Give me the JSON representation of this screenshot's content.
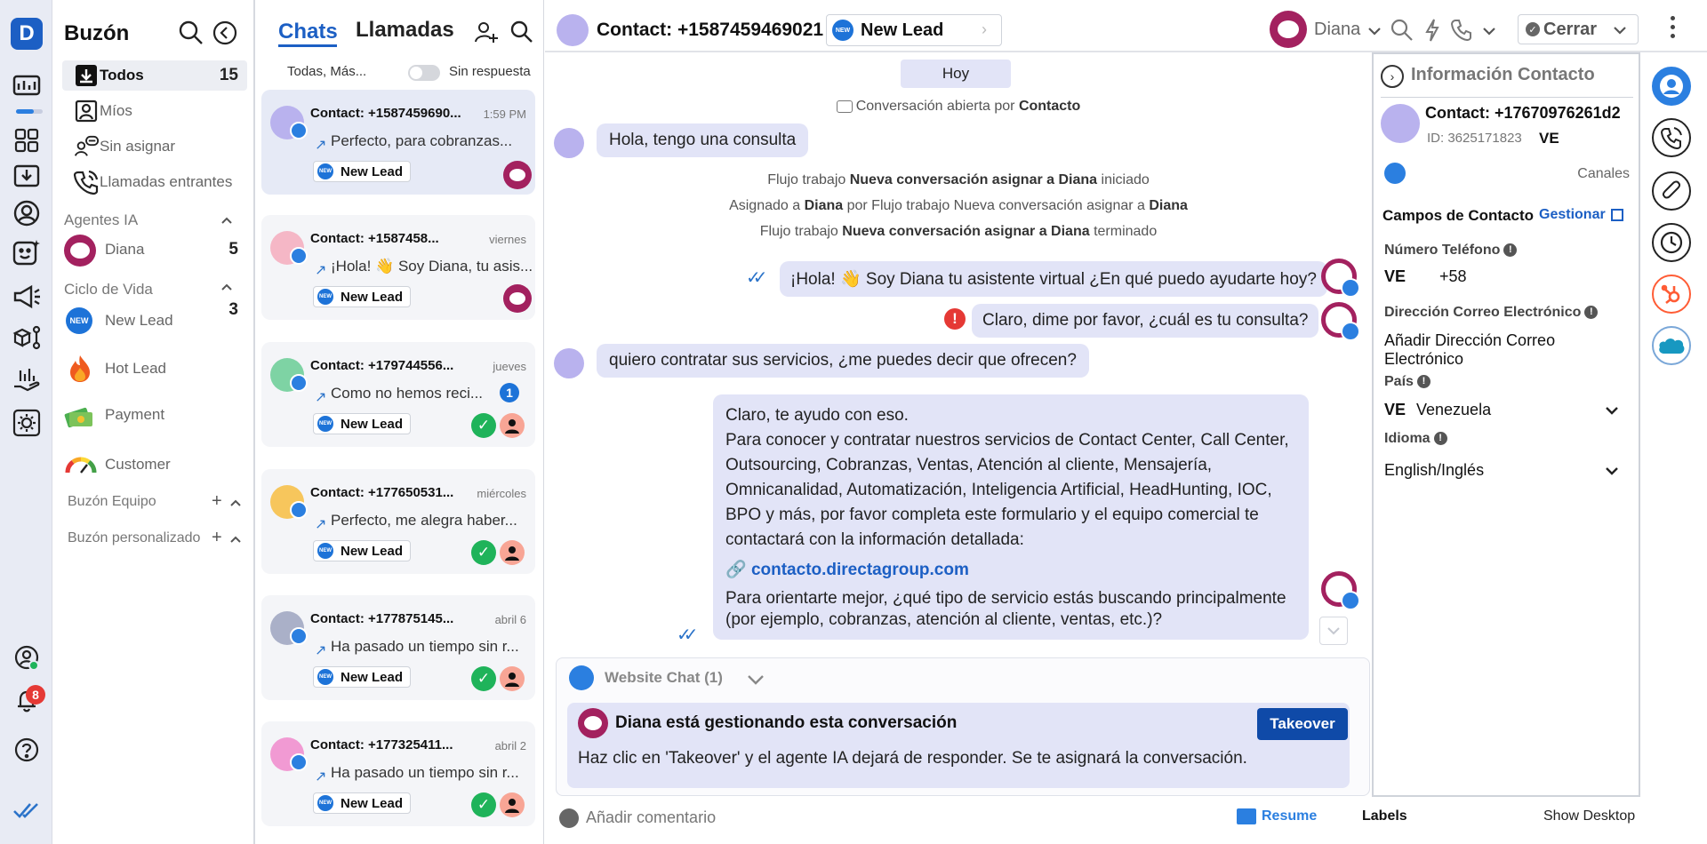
{
  "rail": {
    "logo_letter": "D",
    "notif_count": "8"
  },
  "inbox": {
    "title": "Buzón",
    "items": [
      {
        "label": "Todos",
        "count": "15"
      },
      {
        "label": "Míos",
        "count": ""
      },
      {
        "label": "Sin asignar",
        "count": ""
      },
      {
        "label": "Llamadas entrantes",
        "count": ""
      }
    ],
    "ai_section": "Agentes IA",
    "ai_agent": {
      "label": "Diana",
      "count": "5"
    },
    "life_section": "Ciclo de Vida",
    "life_items": [
      {
        "label": "New Lead",
        "count": "3"
      },
      {
        "label": "Hot Lead",
        "count": ""
      },
      {
        "label": "Payment",
        "count": ""
      },
      {
        "label": "Customer",
        "count": ""
      }
    ],
    "team_section": "Buzón Equipo",
    "custom_section": "Buzón personalizado"
  },
  "chatlist": {
    "tab_chats": "Chats",
    "tab_calls": "Llamadas",
    "filter_label": "Todas, Más...",
    "toggle_label": "Sin respuesta",
    "tag_label": "New Lead",
    "new_badge": "NEW",
    "cards": [
      {
        "name": "Contact: +1587459690...",
        "time": "1:59 PM",
        "msg": "Perfecto, para cobranzas...",
        "unread": "",
        "avatar_color": "#b9b2ee"
      },
      {
        "name": "Contact: +1587458...",
        "time": "viernes",
        "msg": "¡Hola! 👋 Soy Diana, tu asis...",
        "unread": "",
        "avatar_color": "#f5b7c6"
      },
      {
        "name": "Contact: +179744556...",
        "time": "jueves",
        "msg": "Como no hemos reci...",
        "unread": "1",
        "avatar_color": "#7ed3a4"
      },
      {
        "name": "Contact: +177650531...",
        "time": "miércoles",
        "msg": "Perfecto, me alegra haber...",
        "unread": "",
        "avatar_color": "#f7c65c"
      },
      {
        "name": "Contact: +177875145...",
        "time": "abril 6",
        "msg": "Ha pasado un tiempo sin r...",
        "unread": "",
        "avatar_color": "#aab0c8"
      },
      {
        "name": "Contact: +177325411...",
        "time": "abril 2",
        "msg": "Ha pasado un tiempo sin r...",
        "unread": "",
        "avatar_color": "#f19ad3"
      }
    ]
  },
  "topbar": {
    "contact_title": "Contact: +1587459469021",
    "stage_label": "New Lead",
    "agent_name": "Diana",
    "close_label": "Cerrar"
  },
  "conversation": {
    "date_chip": "Hoy",
    "opened_prefix": "Conversación abierta por",
    "opened_by": "Contacto",
    "msg1": "Hola, tengo una consulta",
    "flow1_a": "Flujo trabajo",
    "flow1_b": "Nueva conversación asignar a Diana",
    "flow1_c": "iniciado",
    "assign_a": "Asignado a",
    "assign_b": "Diana",
    "assign_c": "por Flujo trabajo Nueva conversación asignar a",
    "assign_d": "Diana",
    "flow2_a": "Flujo trabajo",
    "flow2_b": "Nueva conversación asignar a Diana",
    "flow2_c": "terminado",
    "msg2": "¡Hola! 👋 Soy Diana tu asistente virtual ¿En qué puedo ayudarte hoy?",
    "msg3": "Claro, dime por favor, ¿cuál es tu consulta?",
    "msg4": "quiero contratar sus servicios, ¿me puedes decir que ofrecen?",
    "msg5_intro": "Claro, te ayudo con eso.",
    "msg5_body": "Para conocer y contratar nuestros servicios de Contact Center, Call Center, Outsourcing, Cobranzas, Ventas, Atención al cliente, Mensajería, Omnicanalidad, Automatización, Inteligencia Artificial, HeadHunting, IOC, BPO y más, por favor completa este formulario y el equipo comercial te contactará con la información detallada:",
    "msg5_link": "contacto.directagroup.com",
    "msg5_outro": "Para orientarte mejor, ¿qué tipo de servicio estás buscando principalmente (por ejemplo, cobranzas, atención al cliente, ventas, etc.)?",
    "channel_label": "Website Chat (1)",
    "ai_banner_title": "Diana está gestionando esta conversación",
    "ai_banner_text": "Haz clic en 'Takeover' y el agente IA dejará de responder. Se te asignará la conversación.",
    "takeover_label": "Takeover",
    "comment_placeholder": "Añadir comentario",
    "resume_label": "Resume",
    "labels_label": "Labels",
    "show_desktop_label": "Show Desktop"
  },
  "info": {
    "title": "Información Contacto",
    "contact_name": "Contact: +17670976261d2",
    "contact_id": "ID: 3625171823",
    "contact_country": "VE",
    "channels_label": "Canales",
    "fields_title": "Campos de Contacto",
    "manage_label": "Gestionar",
    "phone_label": "Número Teléfono",
    "phone_country": "VE",
    "phone_prefix": "+58",
    "email_label": "Dirección Correo Electrónico",
    "email_value": "Añadir Dirección Correo Electrónico",
    "country_label": "País",
    "country_code": "VE",
    "country_value": "Venezuela",
    "lang_label": "Idioma",
    "lang_value": "English/Inglés"
  },
  "colors": {
    "accent": "#1c5fc4",
    "bot": "#a3215f",
    "bubble": "#e2e4f7",
    "rail": "#e8ebf4"
  }
}
